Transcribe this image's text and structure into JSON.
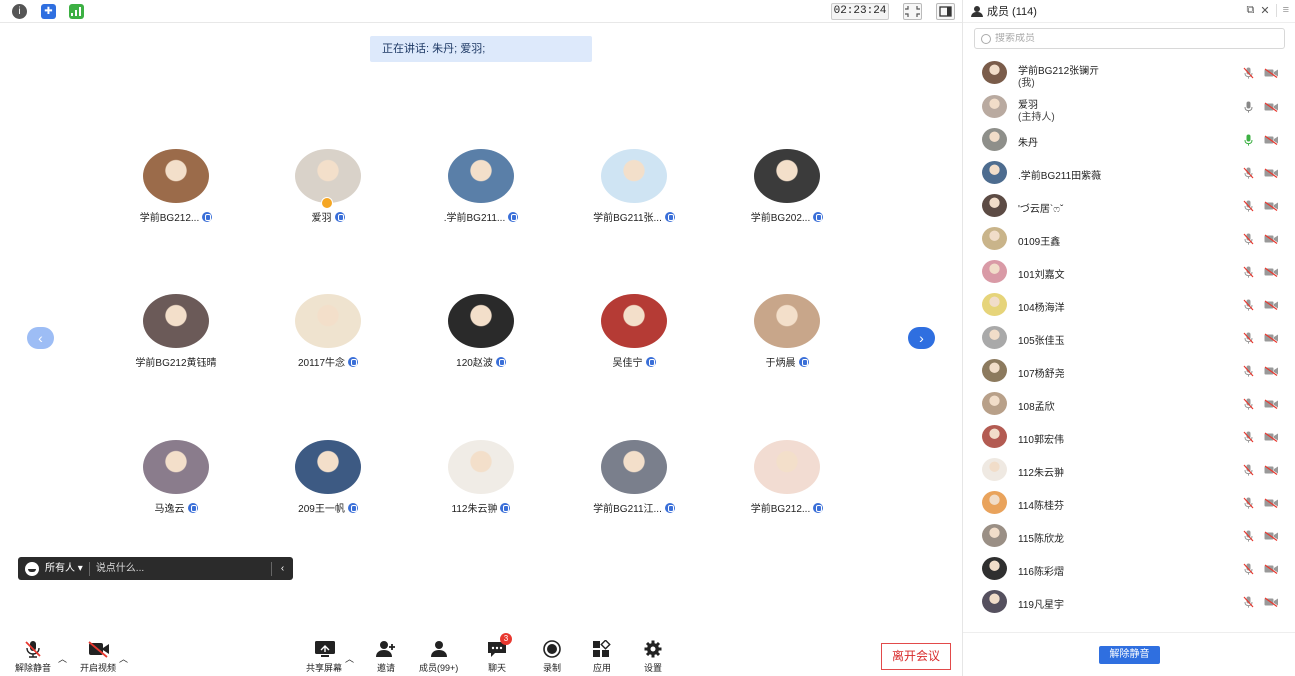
{
  "topbar": {
    "timer": "02:23:24",
    "icons": [
      "info-icon",
      "shield-icon",
      "signal-icon",
      "exit-fullscreen-icon",
      "sidebar-toggle-icon"
    ]
  },
  "speaking_banner": "正在讲话: 朱丹; 爱羽;",
  "grid": {
    "tiles": [
      {
        "name": "学前BG212...",
        "avatar_color": "#9b6b4a"
      },
      {
        "name": "爱羽",
        "avatar_color": "#d9d2c9",
        "host": true
      },
      {
        "name": ".学前BG211...",
        "avatar_color": "#5a7fa8"
      },
      {
        "name": "学前BG211张...",
        "avatar_color": "#cfe4f3"
      },
      {
        "name": "学前BG202...",
        "avatar_color": "#3b3b3b"
      },
      {
        "name": "学前BG212黄钰晴",
        "avatar_color": "#6b5a58",
        "no_badge": true
      },
      {
        "name": "20117牛念",
        "avatar_color": "#efe3cf"
      },
      {
        "name": "120赵波",
        "avatar_color": "#2a2a2a"
      },
      {
        "name": "吴佳宁",
        "avatar_color": "#b53b35"
      },
      {
        "name": "于炳晨",
        "avatar_color": "#c8a68a"
      },
      {
        "name": "马逸云",
        "avatar_color": "#8a7c8c"
      },
      {
        "name": "209王一帆",
        "avatar_color": "#3d5a83"
      },
      {
        "name": "112朱云翀",
        "avatar_color": "#f0ece6"
      },
      {
        "name": "学前BG211江...",
        "avatar_color": "#7a7f8c"
      },
      {
        "name": "学前BG212...",
        "avatar_color": "#f2dcd2"
      }
    ]
  },
  "chat": {
    "target": "所有人",
    "placeholder": "说点什么..."
  },
  "toolbar": {
    "unmute": "解除静音",
    "start_video": "开启视频",
    "share_screen": "共享屏幕",
    "invite": "邀请",
    "members": "成员(99+)",
    "chat": "聊天",
    "chat_badge": "3",
    "record": "录制",
    "apps": "应用",
    "settings": "设置",
    "leave": "离开会议"
  },
  "panel": {
    "title": "成员 (114)",
    "search_placeholder": "搜索成员",
    "unmute_all": "解除静音",
    "members": [
      {
        "name": "学前BG212张镧亓",
        "sub": "(我)",
        "avatar_color": "#7a5c4a",
        "mic": "muted"
      },
      {
        "name": "爱羽",
        "sub": "(主持人)",
        "avatar_color": "#b9aaa0",
        "mic": "on"
      },
      {
        "name": "朱丹",
        "avatar_color": "#8e8f8a",
        "mic": "speaking"
      },
      {
        "name": ".学前BG211田紫薇",
        "avatar_color": "#4d6c8f",
        "mic": "muted"
      },
      {
        "name": "'づ云居`ෆˇ",
        "avatar_color": "#5c4b44",
        "mic": "muted"
      },
      {
        "name": "0109王鑫",
        "avatar_color": "#c9b48a",
        "mic": "muted"
      },
      {
        "name": "101刘嘉文",
        "avatar_color": "#d99aa6",
        "mic": "muted"
      },
      {
        "name": "104杨海洋",
        "avatar_color": "#e6d47a",
        "mic": "muted"
      },
      {
        "name": "105张佳玉",
        "avatar_color": "#a9a9a9",
        "mic": "muted"
      },
      {
        "name": "107杨舒尧",
        "avatar_color": "#8c7a5e",
        "mic": "muted"
      },
      {
        "name": "108孟欣",
        "avatar_color": "#b8a089",
        "mic": "muted"
      },
      {
        "name": "110郭宏伟",
        "avatar_color": "#b35b52",
        "mic": "muted"
      },
      {
        "name": "112朱云翀",
        "avatar_color": "#efe9e2",
        "mic": "muted"
      },
      {
        "name": "114陈桂芬",
        "avatar_color": "#e9a35c",
        "mic": "muted"
      },
      {
        "name": "115陈欣龙",
        "avatar_color": "#9a8f85",
        "mic": "muted"
      },
      {
        "name": "116陈彩熠",
        "avatar_color": "#2f2f2f",
        "mic": "muted"
      },
      {
        "name": "119凡星宇",
        "avatar_color": "#55505e",
        "mic": "muted"
      }
    ]
  }
}
